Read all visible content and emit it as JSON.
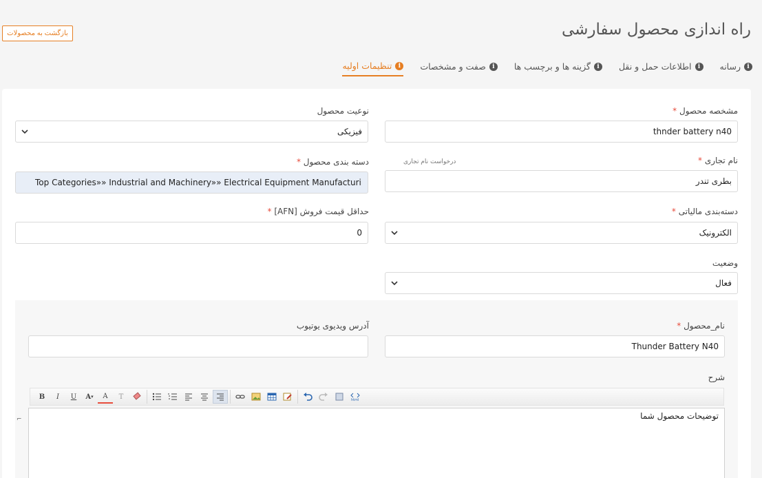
{
  "header": {
    "title": "راه اندازی محصول سفارشی",
    "back_button": "بازگشت به محصولات"
  },
  "tabs": [
    {
      "label": "تنظیمات اولیه",
      "active": true
    },
    {
      "label": "صفت و مشخصات",
      "active": false
    },
    {
      "label": "گزینه ها و برچسب ها",
      "active": false
    },
    {
      "label": "اطلاعات حمل و نقل",
      "active": false
    },
    {
      "label": "رسانه",
      "active": false
    }
  ],
  "form": {
    "product_id": {
      "label": "مشخصه محصول",
      "required": "*",
      "value": "thnder battery n40"
    },
    "product_type": {
      "label": "نوعیت محصول",
      "value": "فیزیکی"
    },
    "trade_name": {
      "label": "نام تجاری",
      "required": "*",
      "note": "درخواست نام تجاری",
      "value": "بطری تندر"
    },
    "category": {
      "label": "دسته بندی محصول",
      "required": "*",
      "value": "Top Categories»» Industrial and Machinery»» Electrical Equipment Manufacturing Machinery"
    },
    "tax_class": {
      "label": "دسته‌بندی مالیاتی",
      "required": "*",
      "value": "الکترونیک"
    },
    "min_price": {
      "label": "حداقل قیمت فروش [AFN]",
      "required": "*",
      "value": "0"
    },
    "status": {
      "label": "وضعیت",
      "value": "فعال"
    }
  },
  "translation": {
    "name": {
      "label": "نام_محصول",
      "required": "*",
      "value": "Thunder Battery N40"
    },
    "youtube": {
      "label": "آدرس ویدیوی یوتیوب",
      "value": ""
    },
    "description": {
      "label": "شرح",
      "content": "توضیحات محصول شما"
    }
  },
  "toolbar": {
    "bold": "B",
    "italic": "I",
    "underline": "U",
    "font_size": "A",
    "font_color": "A",
    "text_style": "T"
  },
  "colors": {
    "accent": "#e67e22",
    "required": "#e74c3c"
  }
}
